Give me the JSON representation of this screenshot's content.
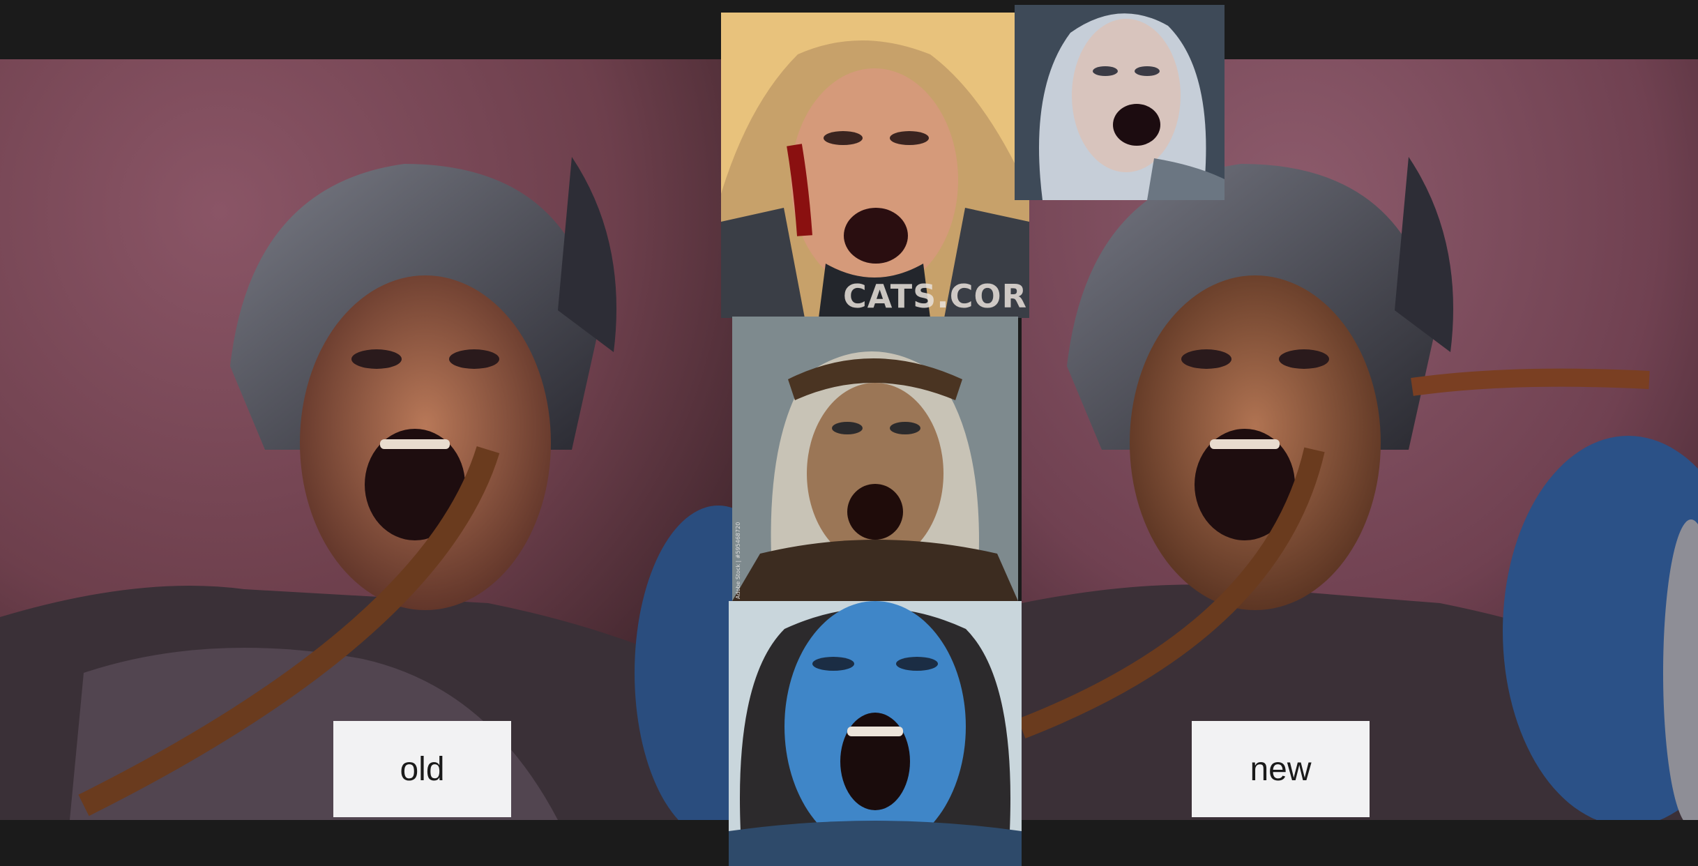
{
  "labels": {
    "old": "old",
    "new": "new"
  },
  "watermarks": {
    "top_center_image": "CATS.CORN",
    "middle_image_side": "Adobe Stock | #595468720"
  },
  "colors": {
    "frame_background": "#1b1b1b",
    "label_background": "#f2f2f3",
    "label_text": "#1a1a1a"
  }
}
